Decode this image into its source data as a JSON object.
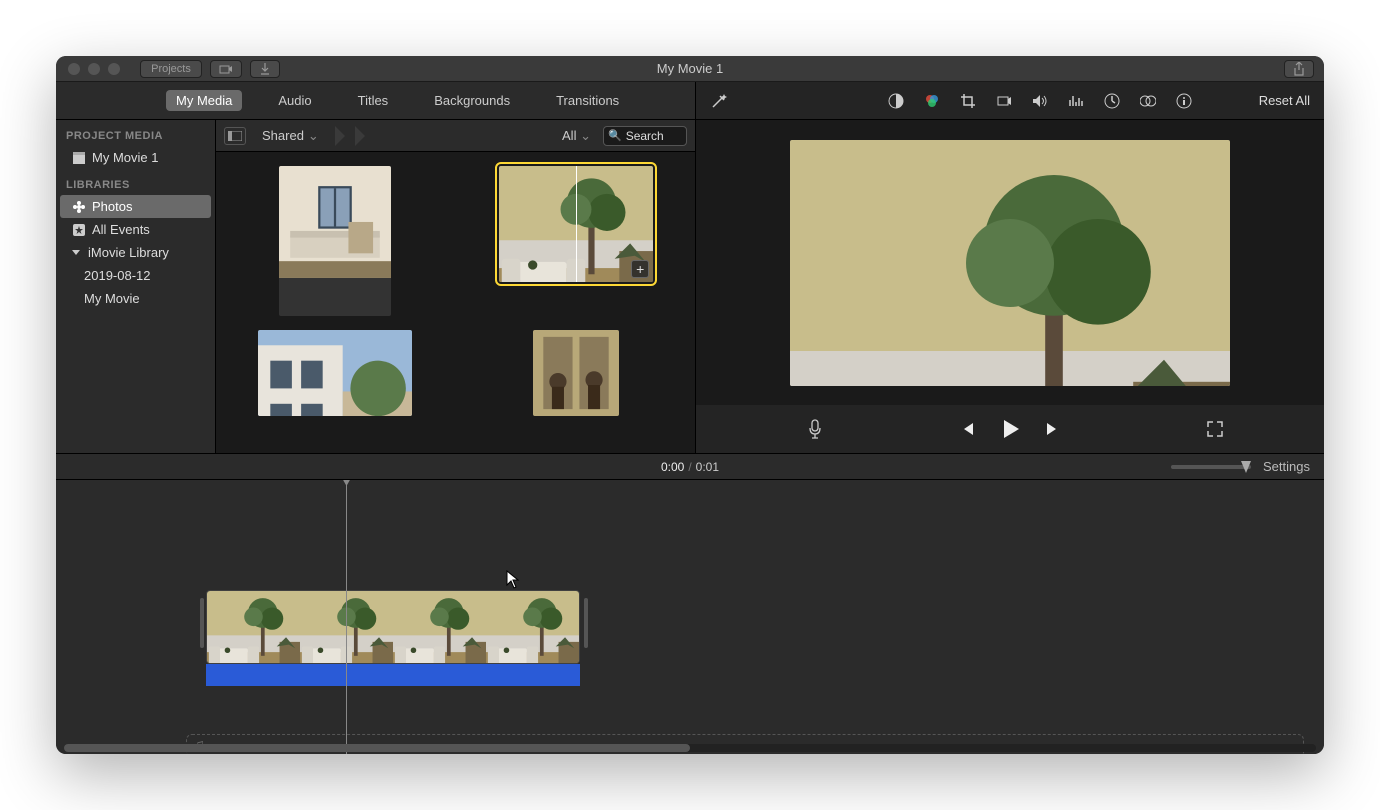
{
  "window": {
    "title": "My Movie 1"
  },
  "titlebar": {
    "projects": "Projects"
  },
  "tabs": {
    "my_media": "My Media",
    "audio": "Audio",
    "titles": "Titles",
    "backgrounds": "Backgrounds",
    "transitions": "Transitions"
  },
  "sidebar": {
    "section_project": "PROJECT MEDIA",
    "project_name": "My Movie 1",
    "section_libraries": "LIBRARIES",
    "photos": "Photos",
    "all_events": "All Events",
    "imovie_library": "iMovie Library",
    "event_date": "2019-08-12",
    "event_movie": "My Movie"
  },
  "browser": {
    "crumb": "Shared",
    "filter": "All",
    "search_placeholder": "Search"
  },
  "preview": {
    "reset": "Reset All"
  },
  "timeline": {
    "current": "0:00",
    "total": "0:01",
    "settings": "Settings"
  }
}
